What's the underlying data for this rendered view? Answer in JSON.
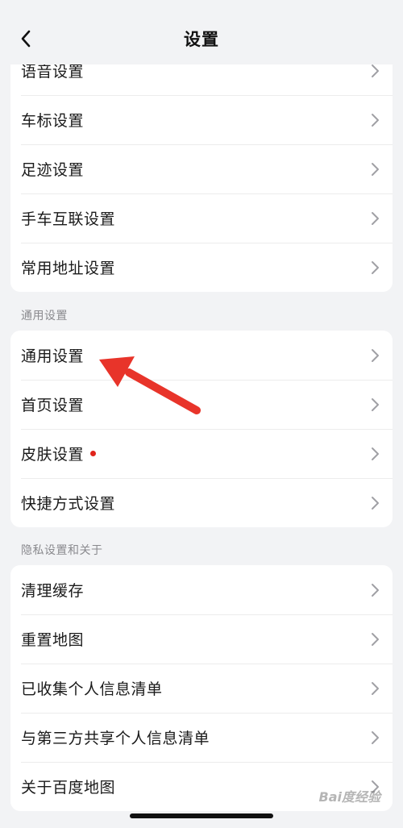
{
  "header": {
    "title": "设置",
    "back_icon": "chevron-left-icon"
  },
  "card1": {
    "items": [
      {
        "label": "语音设置"
      },
      {
        "label": "车标设置"
      },
      {
        "label": "足迹设置"
      },
      {
        "label": "手车互联设置"
      },
      {
        "label": "常用地址设置"
      }
    ]
  },
  "sections": {
    "general": "通用设置",
    "privacy": "隐私设置和关于"
  },
  "card2": {
    "items": [
      {
        "label": "通用设置"
      },
      {
        "label": "首页设置"
      },
      {
        "label": "皮肤设置",
        "badge": "red-dot"
      },
      {
        "label": "快捷方式设置"
      }
    ]
  },
  "card3": {
    "items": [
      {
        "label": "清理缓存"
      },
      {
        "label": "重置地图"
      },
      {
        "label": "已收集个人信息清单"
      },
      {
        "label": "与第三方共享个人信息清单"
      },
      {
        "label": "关于百度地图"
      }
    ]
  },
  "annotation": {
    "type": "red-arrow",
    "color": "#e8342a"
  },
  "watermark": {
    "text": "Bai度经验"
  },
  "colors": {
    "background": "#f2f3f5",
    "card": "#ffffff",
    "badge": "#e0241b",
    "chevron": "#a0a0a5"
  }
}
